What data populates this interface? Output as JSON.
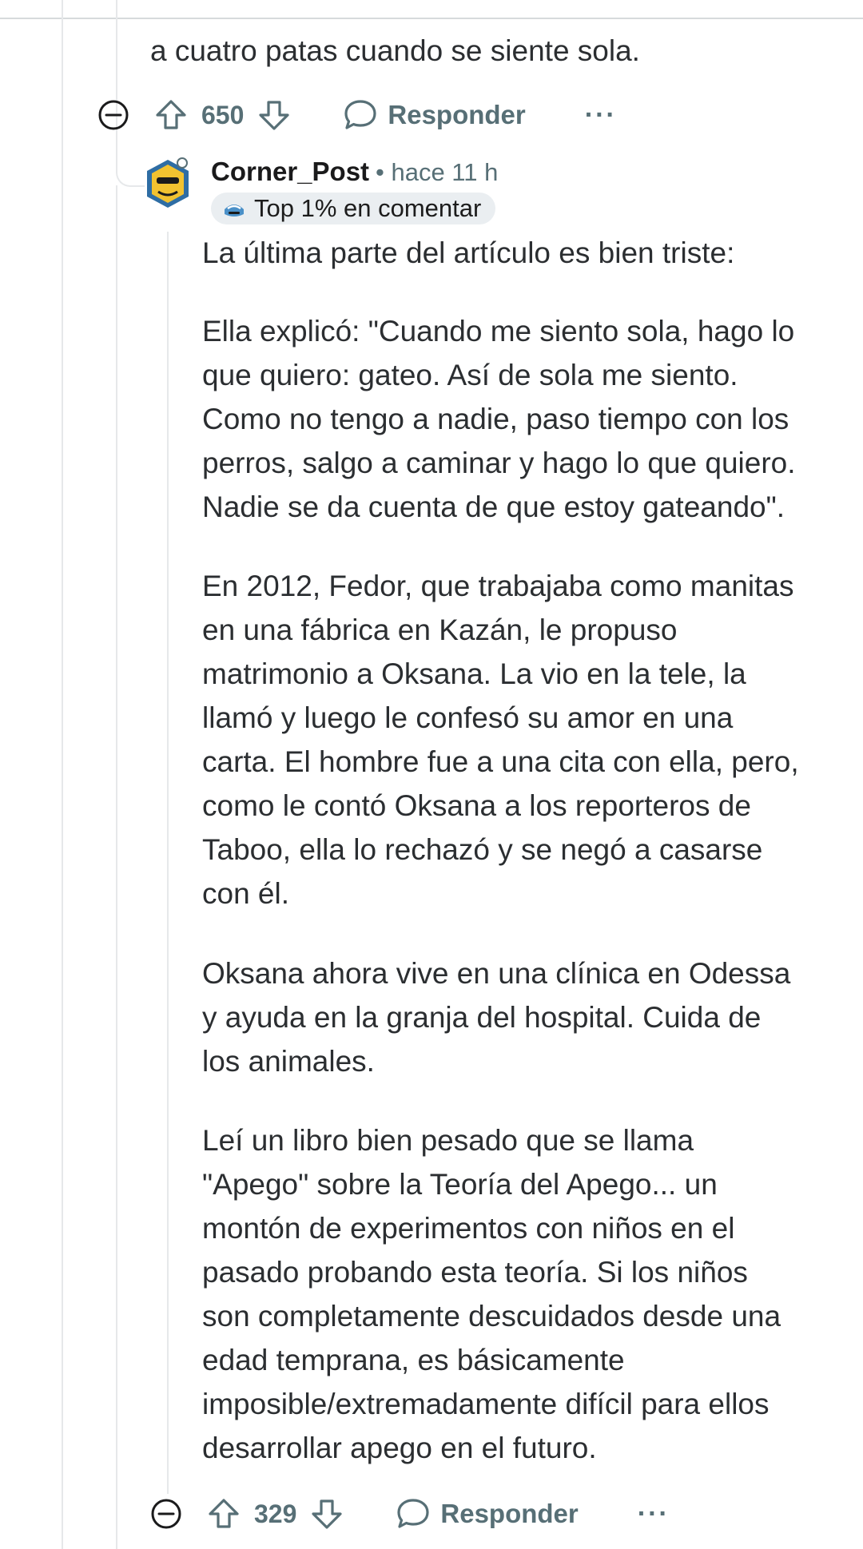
{
  "parent_comment": {
    "text_tail": "a cuatro patas cuando se siente sola.",
    "score": "650",
    "reply_label": "Responder",
    "more_label": "···"
  },
  "reply_comment": {
    "username": "Corner_Post",
    "timestamp": "• hace 11 h",
    "badge": "Top 1% en comentar",
    "paragraphs": [
      "La última parte del artículo es bien triste:",
      "Ella explicó: \"Cuando me siento sola, hago lo\nque quiero: gateo. Así de sola me siento.\nComo no tengo a nadie, paso tiempo con los\nperros, salgo a caminar y hago lo que quiero.\nNadie se da cuenta de que estoy gateando\".",
      "En 2012, Fedor, que trabajaba como manitas\nen una fábrica en Kazán, le propuso\nmatrimonio a Oksana. La vio en la tele, la\nllamó y luego le confesó su amor en una\ncarta. El hombre fue a una cita con ella, pero,\ncomo le contó Oksana a los reporteros de\nTaboo, ella lo rechazó y se negó a casarse\ncon él.",
      "Oksana ahora vive en una clínica en Odessa\ny ayuda en la granja del hospital. Cuida de\nlos animales.",
      "Leí un libro bien pesado que se llama\n\"Apego\" sobre la Teoría del Apego... un\nmontón de experimentos con niños en el\npasado probando esta teoría. Si los niños\nson completamente descuidados desde una\nedad temprana, es básicamente\nimposible/extremadamente difícil para ellos\ndesarrollar apego en el futuro."
    ],
    "score": "329",
    "reply_label": "Responder",
    "more_label": "···"
  },
  "colors": {
    "text": "#2b2e31",
    "meta": "#576f76",
    "icon": "#1a1a1b",
    "thread_line": "#e6e8ea",
    "badge_bg": "#eaeef1"
  }
}
